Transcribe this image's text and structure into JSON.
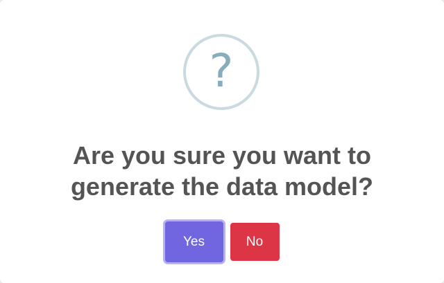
{
  "dialog": {
    "icon": "question-icon",
    "icon_glyph": "?",
    "title_line1": "Are you sure you want to",
    "title_line2": "generate the data model?",
    "confirm_label": "Yes",
    "deny_label": "No"
  },
  "colors": {
    "confirm": "#7066e0",
    "deny": "#dc3545",
    "icon_ring": "#c9dae1",
    "icon_glyph": "#87adbd",
    "title": "#545454"
  }
}
